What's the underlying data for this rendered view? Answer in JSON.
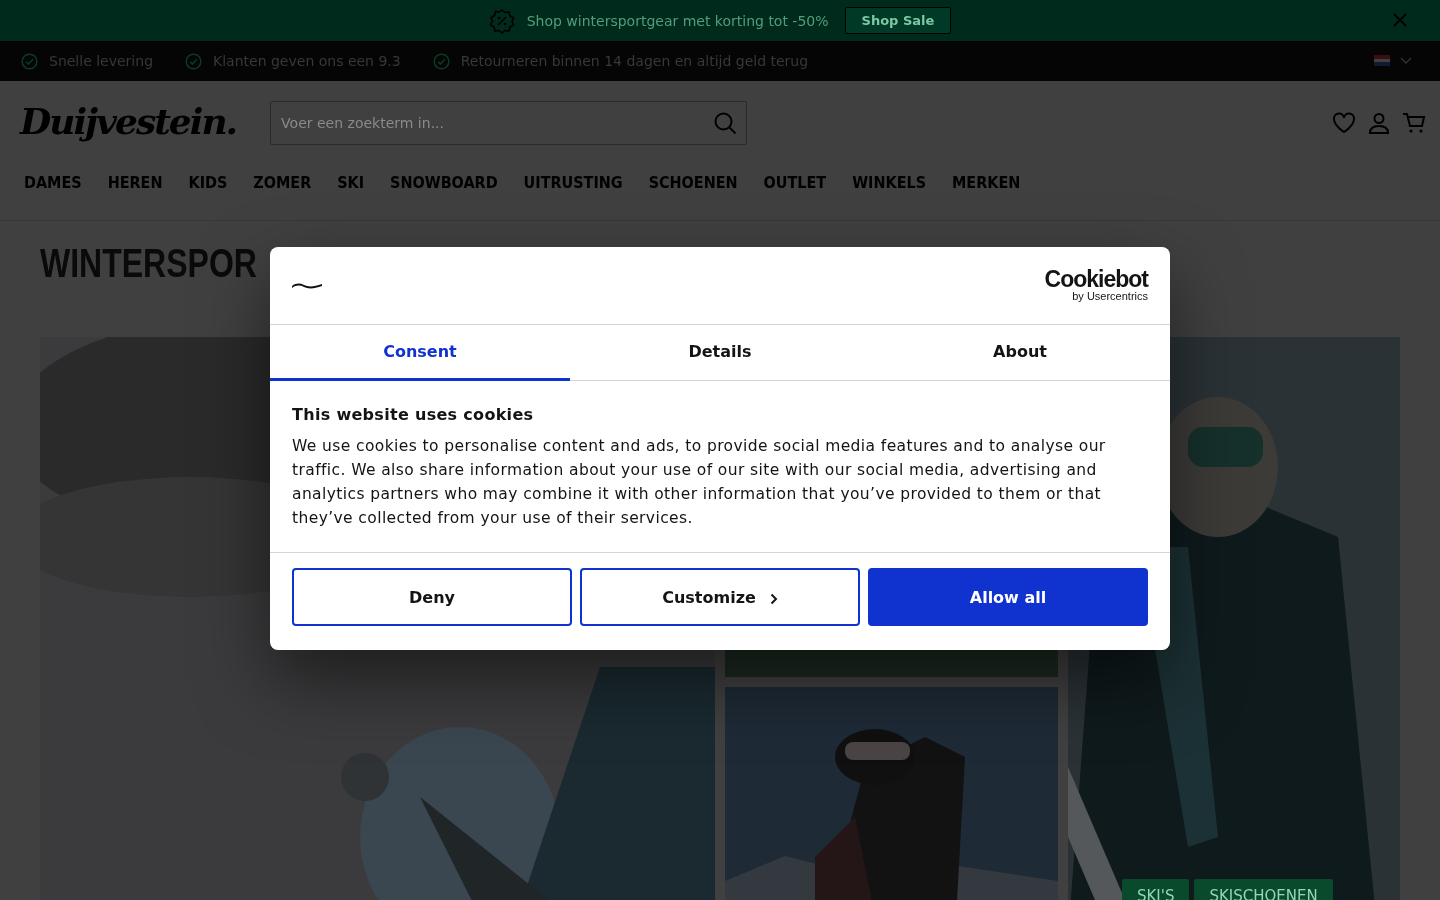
{
  "promo_bar": {
    "text": "Shop wintersportgear met korting tot -50%",
    "button": "Shop Sale"
  },
  "usp_bar": {
    "items": [
      "Snelle levering",
      "Klanten geven ons een 9.3",
      "Retourneren binnen 14 dagen en altijd geld terug"
    ]
  },
  "header": {
    "logo": "Duijvestein.",
    "search": {
      "placeholder": "Voer een zoekterm in..."
    }
  },
  "nav": {
    "items": [
      "DAMES",
      "HEREN",
      "KIDS",
      "ZOMER",
      "SKI",
      "SNOWBOARD",
      "UITRUSTING",
      "SCHOENEN",
      "OUTLET",
      "WINKELS",
      "MERKEN"
    ]
  },
  "page_title": "WINTERSPOR",
  "tiles": [
    {
      "kind": "picture"
    },
    {
      "kind": "picture"
    },
    {
      "kind": "picture"
    },
    {
      "kind": "picture",
      "tags": [
        "SKI'S",
        "SKISCHOENEN"
      ]
    }
  ],
  "cookie_dialog": {
    "brand": {
      "name": "Cookiebot",
      "sub": "by Usercentrics"
    },
    "tabs": [
      {
        "label": "Consent",
        "selected": true
      },
      {
        "label": "Details",
        "selected": false
      },
      {
        "label": "About",
        "selected": false
      }
    ],
    "heading": "This website uses cookies",
    "body": "We use cookies to personalise content and ads, to provide social media features and to analyse our traffic. We also share information about your use of our site with our social media, advertising and analytics partners who may combine it with other information that you’ve provided to them or that they’ve collected from your use of their services.",
    "buttons": [
      {
        "label": "Deny",
        "kind": "outline"
      },
      {
        "label": "Customize",
        "kind": "outline-chevron"
      },
      {
        "label": "Allow all",
        "kind": "primary"
      }
    ]
  }
}
